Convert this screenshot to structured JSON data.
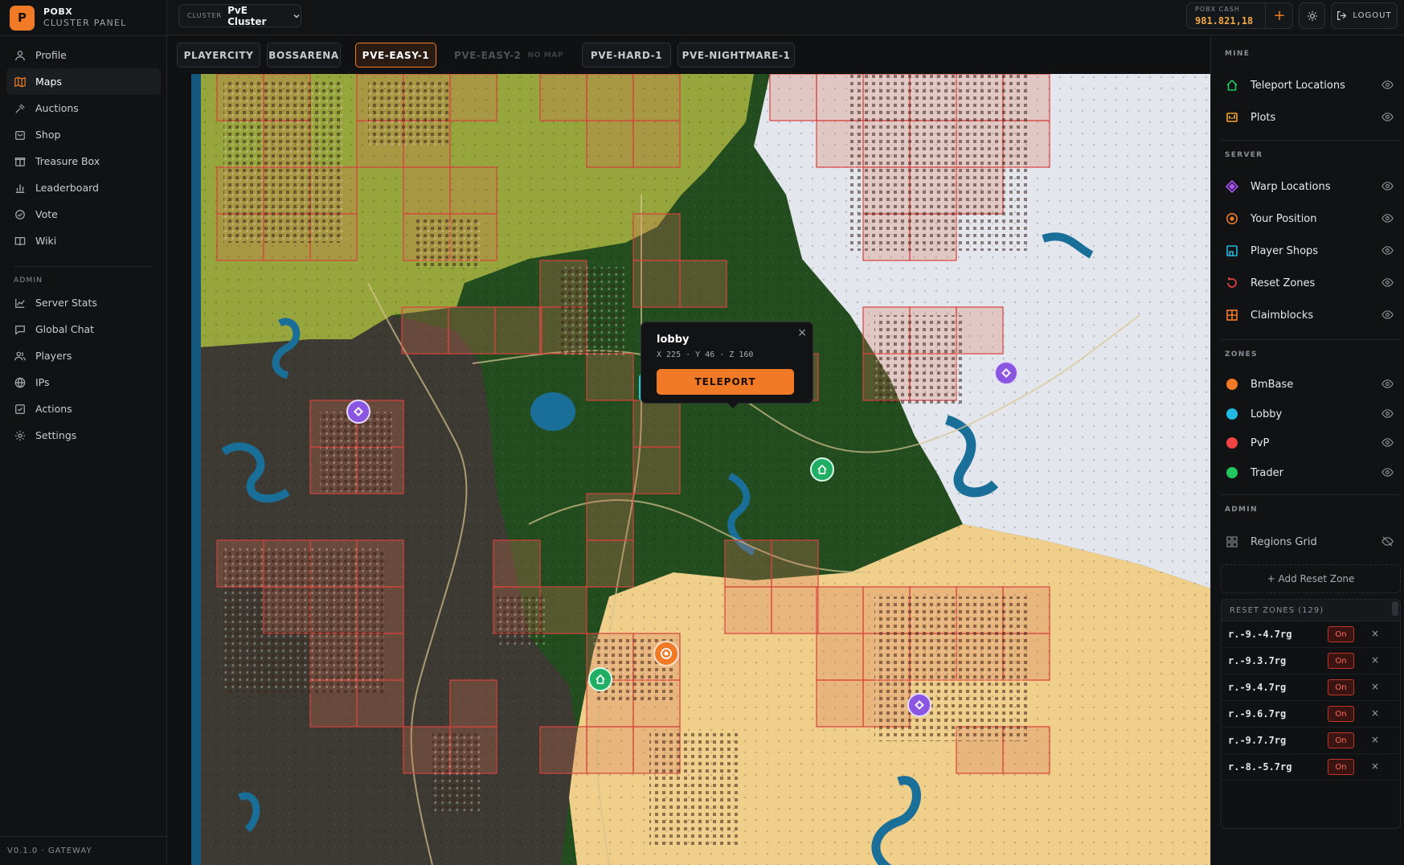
{
  "brand": {
    "logo_letter": "P",
    "name": "POBX",
    "subtitle": "CLUSTER PANEL"
  },
  "sidebar": {
    "main_items": [
      {
        "label": "Profile",
        "icon": "user-icon"
      },
      {
        "label": "Maps",
        "icon": "map-icon",
        "active": true
      },
      {
        "label": "Auctions",
        "icon": "gavel-icon"
      },
      {
        "label": "Shop",
        "icon": "shop-icon"
      },
      {
        "label": "Treasure Box",
        "icon": "box-icon"
      },
      {
        "label": "Leaderboard",
        "icon": "bar-chart-icon"
      },
      {
        "label": "Vote",
        "icon": "check-circle-icon"
      },
      {
        "label": "Wiki",
        "icon": "book-icon"
      }
    ],
    "admin_label": "ADMIN",
    "admin_items": [
      {
        "label": "Server Stats",
        "icon": "line-chart-icon"
      },
      {
        "label": "Global Chat",
        "icon": "chat-icon"
      },
      {
        "label": "Players",
        "icon": "users-icon"
      },
      {
        "label": "IPs",
        "icon": "globe-icon"
      },
      {
        "label": "Actions",
        "icon": "checklist-icon"
      },
      {
        "label": "Settings",
        "icon": "gear-icon"
      }
    ],
    "version": "V0.1.0 · GATEWAY"
  },
  "topbar": {
    "cluster_caption": "CLUSTER",
    "cluster_value": "PvE Cluster",
    "cash_caption": "POBX CASH",
    "cash_value": "981.821,18",
    "cash_add": "+",
    "logout_label": "LOGOUT"
  },
  "tabs": [
    {
      "label": "PLAYERCITY"
    },
    {
      "label": "BOSSARENA"
    },
    {
      "label": "PVE-EASY-1",
      "active": true
    },
    {
      "label": "PVE-EASY-2",
      "badge": "NO MAP",
      "disabled": true
    },
    {
      "label": "PVE-HARD-1"
    },
    {
      "label": "PVE-NIGHTMARE-1"
    }
  ],
  "popup": {
    "title": "lobby",
    "coords": "X 225 · Y 46 · Z 160",
    "button": "TELEPORT",
    "close": "×"
  },
  "layers": {
    "mine_label": "MINE",
    "mine": [
      {
        "label": "Teleport Locations",
        "icon": "home-icon",
        "color": "#22c55e"
      },
      {
        "label": "Plots",
        "icon": "plot-icon",
        "color": "#f5a524"
      }
    ],
    "server_label": "SERVER",
    "server": [
      {
        "label": "Warp Locations",
        "icon": "diamond-icon",
        "color": "#a855f7"
      },
      {
        "label": "Your Position",
        "icon": "target-icon",
        "color": "#f07a26"
      },
      {
        "label": "Player Shops",
        "icon": "store-icon",
        "color": "#22b8e0"
      },
      {
        "label": "Reset Zones",
        "icon": "reset-icon",
        "color": "#ef4444"
      },
      {
        "label": "Claimblocks",
        "icon": "grid-icon",
        "color": "#f07a26"
      }
    ],
    "zones_label": "ZONES",
    "zones": [
      {
        "label": "BmBase",
        "color": "#f07a26"
      },
      {
        "label": "Lobby",
        "color": "#22b8e0"
      },
      {
        "label": "PvP",
        "color": "#ef4444"
      },
      {
        "label": "Trader",
        "color": "#22c55e"
      }
    ],
    "admin_label": "ADMIN",
    "admin": [
      {
        "label": "Regions Grid",
        "icon": "grid4-icon",
        "color": "#6b7075"
      }
    ]
  },
  "reset_zones": {
    "add_label": "+ Add Reset Zone",
    "header": "RESET ZONES (129)",
    "rows": [
      {
        "name": "r.-9.-4.7rg",
        "state": "On"
      },
      {
        "name": "r.-9.3.7rg",
        "state": "On"
      },
      {
        "name": "r.-9.4.7rg",
        "state": "On"
      },
      {
        "name": "r.-9.6.7rg",
        "state": "On"
      },
      {
        "name": "r.-9.7.7rg",
        "state": "On"
      },
      {
        "name": "r.-8.-5.7rg",
        "state": "On"
      }
    ],
    "remove_glyph": "×"
  }
}
